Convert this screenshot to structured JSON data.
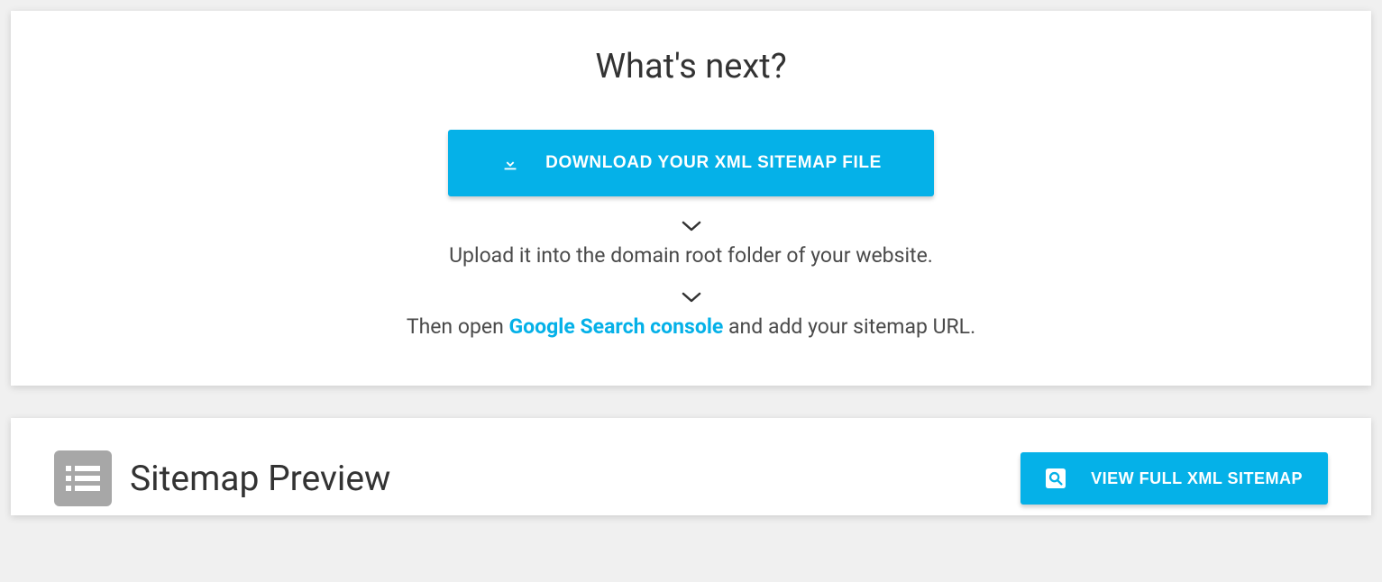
{
  "colors": {
    "primary": "#05b1e8"
  },
  "whatsNext": {
    "title": "What's next?",
    "downloadLabel": "DOWNLOAD YOUR XML SITEMAP FILE",
    "step2": "Upload it into the domain root folder of your website.",
    "step3Before": "Then open ",
    "step3Link": "Google Search console",
    "step3After": " and add your sitemap URL."
  },
  "preview": {
    "title": "Sitemap Preview",
    "viewLabel": "VIEW FULL XML SITEMAP"
  }
}
